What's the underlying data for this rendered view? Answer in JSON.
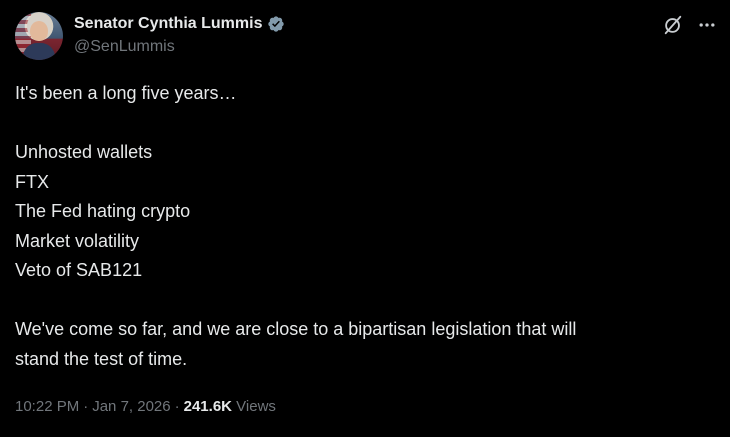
{
  "author": {
    "display_name": "Senator Cynthia Lummis",
    "handle": "@SenLummis",
    "verified_color": "#829aab"
  },
  "tweet": {
    "lines": [
      "It's been a long five years…",
      "",
      "Unhosted wallets",
      "FTX",
      "The Fed hating crypto",
      "Market volatility",
      "Veto of SAB121",
      "",
      "We've come so far, and we are close to a bipartisan legislation that will",
      "stand the test of time."
    ]
  },
  "meta": {
    "time": "10:22 PM",
    "date": "Jan 7, 2026",
    "views_count": "241.6K",
    "views_label": "Views",
    "separator": "·"
  },
  "icons": {
    "grok": "grok-icon",
    "more": "more-icon",
    "verified": "verified-badge-icon"
  },
  "colors": {
    "background": "#000000",
    "primary_text": "#e7e9ea",
    "secondary_text": "#71767b"
  }
}
